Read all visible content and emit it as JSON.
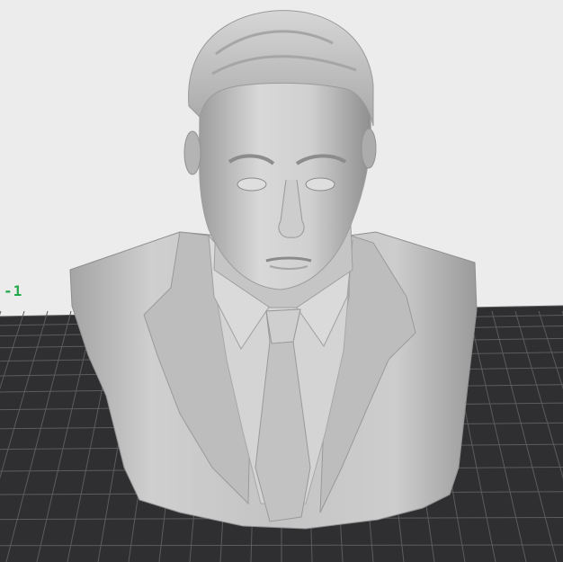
{
  "viewport": {
    "background_color": "#ececec",
    "bed_color": "#2f2f31",
    "grid_color": "#5c5c5f",
    "model_color": "#c9c9c9",
    "model_name_icon": "bust-3d-model"
  },
  "axis": {
    "label": "-1",
    "color": "#22a84a"
  }
}
